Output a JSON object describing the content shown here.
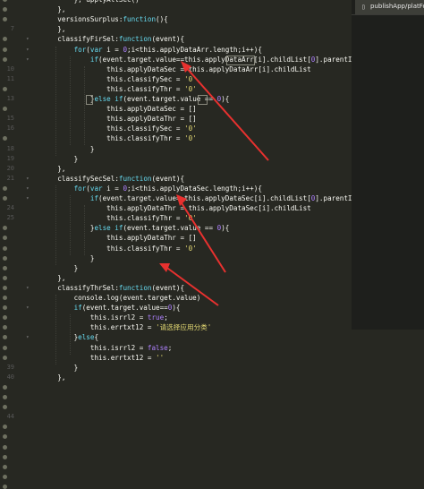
{
  "panel": {
    "tab_icon": "document-icon",
    "tab_label": "publishApp/platFor"
  },
  "line_numbers": [
    "",
    "",
    "",
    "7",
    "",
    "",
    "",
    "10",
    "11",
    "",
    "13",
    "",
    "15",
    "16",
    "",
    "18",
    "19",
    "20",
    "21",
    "",
    "",
    "24",
    "25",
    "",
    "",
    "",
    "",
    "",
    "",
    "",
    "",
    "",
    "",
    "",
    "",
    "",
    "",
    "39",
    "40",
    "",
    "",
    "",
    "44",
    "",
    "",
    "",
    "",
    "",
    "",
    ""
  ],
  "code_lines": [
    [
      [
        "        ",
        ""
      ],
      [
        "},",
        "txt"
      ],
      [
        " ",
        "txt"
      ],
      [
        "applyAllSec",
        "txt"
      ],
      [
        "()",
        "txt"
      ]
    ],
    [
      [
        "    ",
        ""
      ],
      [
        "},",
        "txt"
      ]
    ],
    [
      [
        "    ",
        ""
      ],
      [
        "versionsSurplus",
        "txt"
      ],
      [
        ":",
        "txt"
      ],
      [
        "function",
        "kw"
      ],
      [
        "(){",
        "txt"
      ]
    ],
    [
      [
        "    ",
        ""
      ],
      [
        "},",
        "txt"
      ]
    ],
    [
      [
        "    ",
        ""
      ],
      [
        "classifyFirSel",
        "txt"
      ],
      [
        ":",
        "txt"
      ],
      [
        "function",
        "kw"
      ],
      [
        "(event){",
        "txt"
      ]
    ],
    [
      [
        "        ",
        ""
      ],
      [
        "for",
        "kw"
      ],
      [
        "(",
        "txt"
      ],
      [
        "var",
        "kw"
      ],
      [
        " i = ",
        "txt"
      ],
      [
        "0",
        "num"
      ],
      [
        ";i<this.applyDataArr.length;i++){",
        "txt"
      ]
    ],
    [
      [
        "            ",
        ""
      ],
      [
        "if",
        "kw"
      ],
      [
        "(event.target.value==this.applyDataArr[i].childList[",
        "txt"
      ],
      [
        "0",
        "num"
      ],
      [
        "].parentId){",
        "txt"
      ]
    ],
    [
      [
        "                ",
        ""
      ],
      [
        "this.applyDataSec = this.applyDataArr[i].childList",
        "txt"
      ]
    ],
    [
      [
        "                ",
        ""
      ],
      [
        "this.classifySec = ",
        "txt"
      ],
      [
        "'0'",
        "str"
      ]
    ],
    [
      [
        "                ",
        ""
      ],
      [
        "this.classifyThr = ",
        "txt"
      ],
      [
        "'0'",
        "str"
      ]
    ],
    [
      [
        "            ",
        ""
      ],
      [
        "}",
        "txt"
      ],
      [
        "else if",
        "kw"
      ],
      [
        "(event.target.value == ",
        "txt"
      ],
      [
        "0",
        "num"
      ],
      [
        "){",
        "txt"
      ]
    ],
    [
      [
        "                ",
        ""
      ],
      [
        "this.applyDataSec = []",
        "txt"
      ]
    ],
    [
      [
        "                ",
        ""
      ],
      [
        "this.applyDataThr = []",
        "txt"
      ]
    ],
    [
      [
        "                ",
        ""
      ],
      [
        "this.classifySec = ",
        "txt"
      ],
      [
        "'0'",
        "str"
      ]
    ],
    [
      [
        "                ",
        ""
      ],
      [
        "this.classifyThr = ",
        "txt"
      ],
      [
        "'0'",
        "str"
      ]
    ],
    [
      [
        "            ",
        ""
      ],
      [
        "}",
        "txt"
      ]
    ],
    [
      [
        "        ",
        ""
      ],
      [
        "}",
        "txt"
      ]
    ],
    [
      [
        "    ",
        ""
      ],
      [
        "},",
        "txt"
      ]
    ],
    [
      [
        "    ",
        ""
      ],
      [
        "classifySecSel",
        "txt"
      ],
      [
        ":",
        "txt"
      ],
      [
        "function",
        "kw"
      ],
      [
        "(event){",
        "txt"
      ]
    ],
    [
      [
        "        ",
        ""
      ],
      [
        "for",
        "kw"
      ],
      [
        "(",
        "txt"
      ],
      [
        "var",
        "kw"
      ],
      [
        " i = ",
        "txt"
      ],
      [
        "0",
        "num"
      ],
      [
        ";i<this.applyDataSec.length;i++){",
        "txt"
      ]
    ],
    [
      [
        "            ",
        ""
      ],
      [
        "if",
        "kw"
      ],
      [
        "(event.target.value==this.applyDataSec[i].childList[",
        "txt"
      ],
      [
        "0",
        "num"
      ],
      [
        "].parentId){",
        "txt"
      ]
    ],
    [
      [
        "                ",
        ""
      ],
      [
        "this.applyDataThr = this.applyDataSec[i].childList",
        "txt"
      ]
    ],
    [
      [
        "                ",
        ""
      ],
      [
        "this.classifyThr = ",
        "txt"
      ],
      [
        "'0'",
        "str"
      ]
    ],
    [
      [
        "            ",
        ""
      ],
      [
        "}",
        "txt"
      ],
      [
        "else if",
        "kw"
      ],
      [
        "(event.target.value == ",
        "txt"
      ],
      [
        "0",
        "num"
      ],
      [
        "){",
        "txt"
      ]
    ],
    [
      [
        "                ",
        ""
      ],
      [
        "this.applyDataThr = []",
        "txt"
      ]
    ],
    [
      [
        "                ",
        ""
      ],
      [
        "this.classifyThr = ",
        "txt"
      ],
      [
        "'0'",
        "str"
      ]
    ],
    [
      [
        "            ",
        ""
      ],
      [
        "}",
        "txt"
      ]
    ],
    [
      [
        "        ",
        ""
      ],
      [
        "}",
        "txt"
      ]
    ],
    [
      [
        "    ",
        ""
      ],
      [
        "},",
        "txt"
      ]
    ],
    [
      [
        "    ",
        ""
      ],
      [
        "classifyThrSel",
        "txt"
      ],
      [
        ":",
        "txt"
      ],
      [
        "function",
        "kw"
      ],
      [
        "(event){",
        "txt"
      ]
    ],
    [
      [
        "        ",
        ""
      ],
      [
        "console",
        "txt"
      ],
      [
        ".log(event.target.value)",
        "txt"
      ]
    ],
    [
      [
        "        ",
        ""
      ],
      [
        "if",
        "kw"
      ],
      [
        "(event.target.value==",
        "txt"
      ],
      [
        "0",
        "num"
      ],
      [
        "){",
        "txt"
      ]
    ],
    [
      [
        "            ",
        ""
      ],
      [
        "this.isrrl2 = ",
        "txt"
      ],
      [
        "true",
        "num"
      ],
      [
        ";",
        "txt"
      ]
    ],
    [
      [
        "            ",
        ""
      ],
      [
        "this.errtxt12 = ",
        "txt"
      ],
      [
        "'请选择应用分类'",
        "str"
      ]
    ],
    [
      [
        "        ",
        ""
      ],
      [
        "}",
        "txt"
      ],
      [
        "else",
        "kw"
      ],
      [
        "{",
        "txt"
      ]
    ],
    [
      [
        "            ",
        ""
      ],
      [
        "this.isrrl2 = ",
        "txt"
      ],
      [
        "false",
        "num"
      ],
      [
        ";",
        "txt"
      ]
    ],
    [
      [
        "            ",
        ""
      ],
      [
        "this.errtxt12 = ",
        "txt"
      ],
      [
        "''",
        "str"
      ]
    ],
    [
      [
        "        ",
        ""
      ],
      [
        "}",
        "txt"
      ]
    ],
    [
      [
        "    ",
        ""
      ],
      [
        "},",
        "txt"
      ]
    ]
  ],
  "colors": {
    "background": "#272822",
    "arrow": "#e8312f",
    "keyword": "#66d9ef",
    "string": "#e6db74",
    "number": "#ae81ff",
    "text": "#f8f8f2"
  }
}
